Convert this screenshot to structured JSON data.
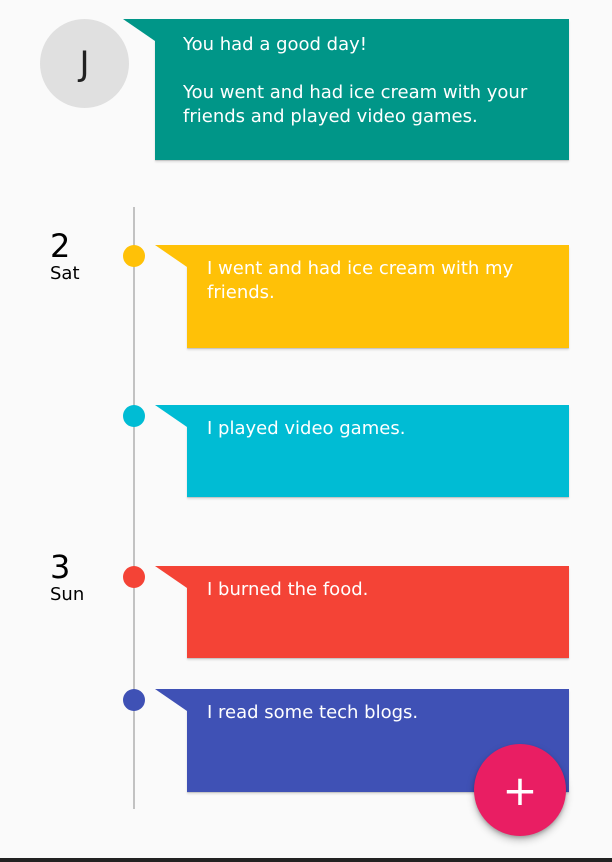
{
  "profile": {
    "initial": "J"
  },
  "summary": {
    "text": "You had a good day!\n\nYou went and had ice cream with your friends and played video games.",
    "color": "#009688"
  },
  "days": [
    {
      "number": "2",
      "weekday": "Sat"
    },
    {
      "number": "3",
      "weekday": "Sun"
    }
  ],
  "entries": [
    {
      "text": "I went and had ice cream with my friends.",
      "color": "#ffc107"
    },
    {
      "text": "I played video games.",
      "color": "#00bcd4"
    },
    {
      "text": "I burned the food.",
      "color": "#f44336"
    },
    {
      "text": "I read some tech blogs.",
      "color": "#3f51b5"
    }
  ],
  "fab": {
    "icon": "plus-icon",
    "label": "+",
    "color": "#e91e63"
  }
}
